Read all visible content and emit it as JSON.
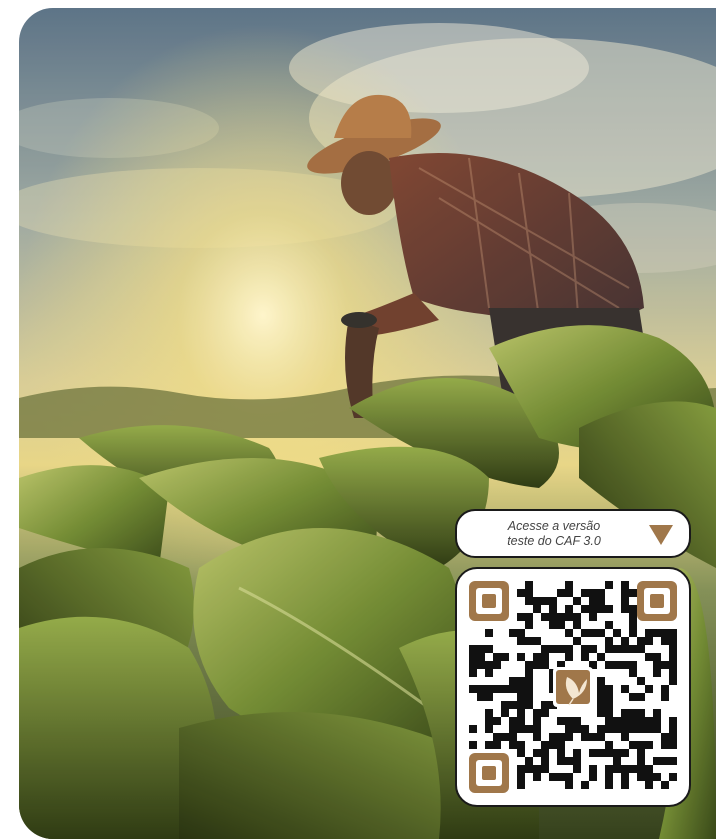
{
  "cta": {
    "line1": "Acesse a versão",
    "line2": "teste do CAF 3.0",
    "arrow_icon": "triangle-down-icon",
    "arrow_color": "#a0774a"
  },
  "qr": {
    "accent_color": "#a0774a",
    "center_icon": "tobacco-leaf-icon"
  },
  "photo": {
    "subject": "farmer-in-tobacco-field"
  }
}
